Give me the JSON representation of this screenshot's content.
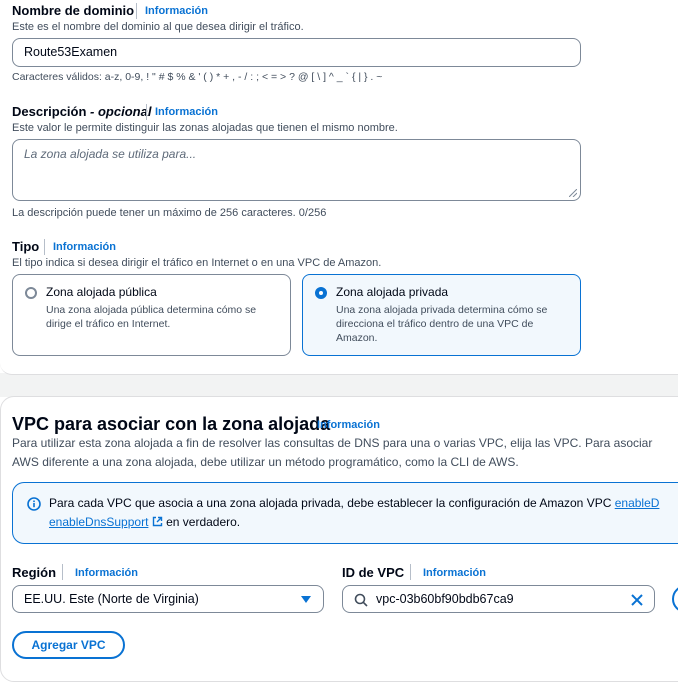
{
  "domain_name": {
    "label": "Nombre de dominio",
    "info": "Información",
    "description": "Este es el nombre del dominio al que desea dirigir el tráfico.",
    "value": "Route53Examen",
    "constraint": "Caracteres válidos: a-z, 0-9, ! \" # $ % & ' ( ) * + , - / : ; < = > ? @ [ \\ ] ^ _ ` { | } . ~"
  },
  "description_field": {
    "label": "Descripción",
    "optional": "- opcional",
    "info": "Información",
    "description": "Este valor le permite distinguir las zonas alojadas que tienen el mismo nombre.",
    "placeholder": "La zona alojada se utiliza para...",
    "constraint": "La descripción puede tener un máximo de 256 caracteres. 0/256"
  },
  "type": {
    "label": "Tipo",
    "info": "Información",
    "description": "El tipo indica si desea dirigir el tráfico en Internet o en una VPC de Amazon.",
    "options": [
      {
        "title": "Zona alojada pública",
        "desc": "Una zona alojada pública determina cómo se dirige el tráfico en Internet.",
        "selected": false
      },
      {
        "title": "Zona alojada privada",
        "desc": "Una zona alojada privada determina cómo se direcciona el tráfico dentro de una VPC de Amazon.",
        "selected": true
      }
    ]
  },
  "vpc_section": {
    "title": "VPC para asociar con la zona alojada",
    "info": "Información",
    "paragraph_line1": "Para utilizar esta zona alojada a fin de resolver las consultas de DNS para una o varias VPC, elija las VPC. Para asociar",
    "paragraph_line2": "AWS diferente a una zona alojada, debe utilizar un método programático, como la CLI de AWS.",
    "alert_line1": "Para cada VPC que asocia a una zona alojada privada, debe establecer la configuración de Amazon VPC",
    "alert_link1": "enableD",
    "alert_link2": "enableDnsSupport",
    "alert_tail": "en verdadero.",
    "region_label": "Región",
    "region_info": "Información",
    "region_value": "EE.UU. Este (Norte de Virginia)",
    "vpc_id_label": "ID de VPC",
    "vpc_id_info": "Información",
    "vpc_id_value": "vpc-03b60bf90bdb67ca9",
    "add_button": "Agregar VPC"
  }
}
